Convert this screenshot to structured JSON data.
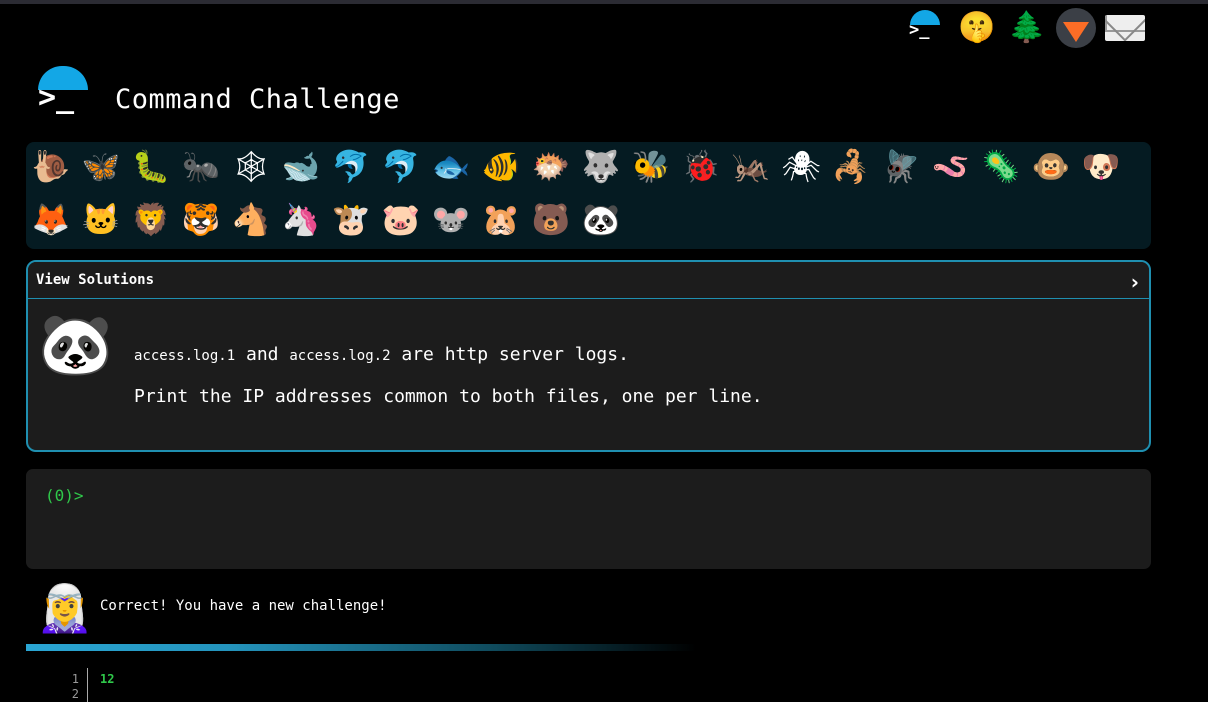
{
  "header": {
    "title": "Command Challenge",
    "logo_glyph": ">_"
  },
  "top_icons": [
    {
      "name": "terminal-logo-icon",
      "glyph": ">_"
    },
    {
      "name": "shushing-face-icon",
      "glyph": "🤫"
    },
    {
      "name": "evergreen-tree-icon",
      "glyph": "🌲"
    },
    {
      "name": "gitlab-icon",
      "glyph": ""
    },
    {
      "name": "envelope-icon",
      "glyph": ""
    }
  ],
  "animals_row1": [
    "🐌",
    "🦋",
    "🐛",
    "🐜",
    "🕸",
    "🐋",
    "🐬",
    "🐬",
    "🐟",
    "🐠",
    "🐡",
    "🐺",
    "🐝",
    "🐞",
    "🦗",
    "🕷",
    "🦂",
    "🪰",
    "🪱",
    "🦠",
    "🐵",
    "🐶"
  ],
  "animals_row2": [
    "🦊",
    "🐱",
    "🦁",
    "🐯",
    "🐴",
    "🦄",
    "🐮",
    "🐷",
    "🐭",
    "🐹",
    "🐻",
    "🐼"
  ],
  "challenge": {
    "solutions_label": "View Solutions",
    "chevron": "›",
    "avatar": "🐼",
    "file1": "access.log.1",
    "and": "and",
    "file2": "access.log.2",
    "rest": "are http server logs.",
    "description": "Print the IP addresses common to both files, one per line."
  },
  "terminal": {
    "prompt": "(0)>",
    "input_value": ""
  },
  "status": {
    "avatar": "🧝‍♀️",
    "message": "Correct! You have a new challenge!"
  },
  "output": {
    "line_numbers": [
      "1",
      "2"
    ],
    "first_line": "12"
  }
}
